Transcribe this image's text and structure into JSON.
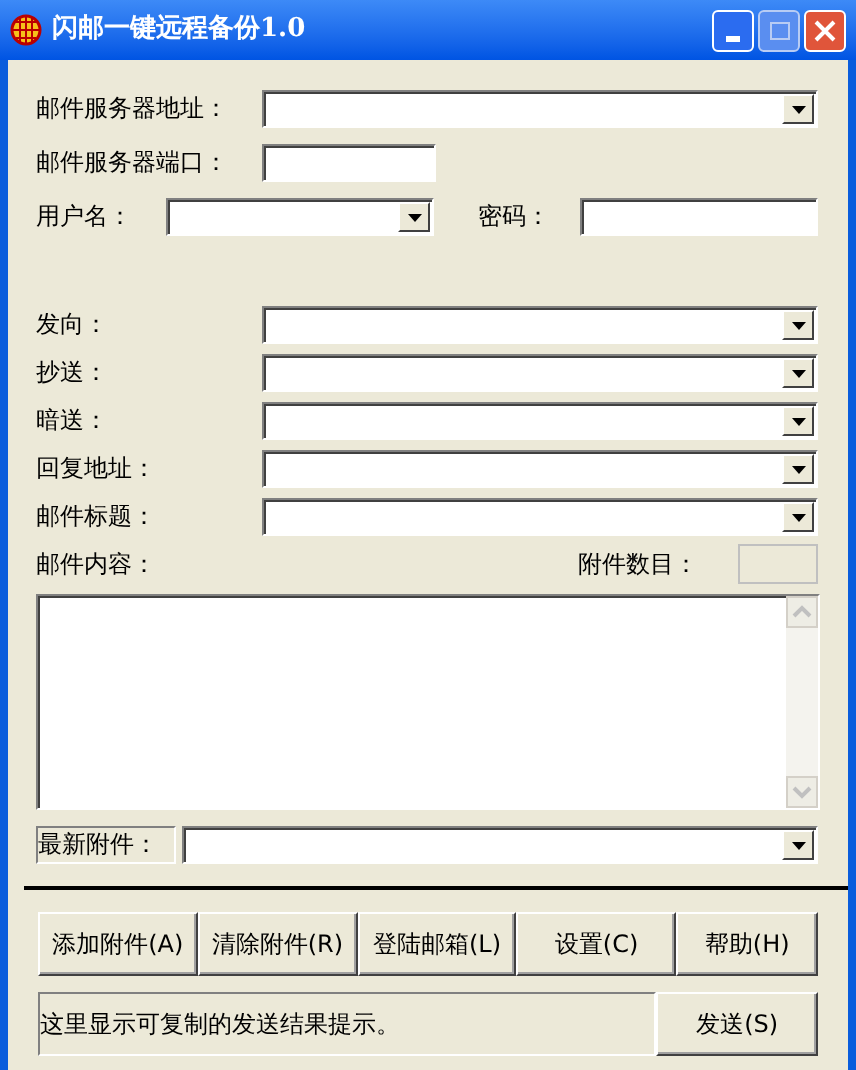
{
  "window": {
    "title": "闪邮一键远程备份1.0"
  },
  "server_address": {
    "label": "邮件服务器地址："
  },
  "server_port": {
    "label": "邮件服务器端口："
  },
  "username": {
    "label": "用户名："
  },
  "password": {
    "label": "密码："
  },
  "recipients": [
    {
      "label": "发向："
    },
    {
      "label": "抄送："
    },
    {
      "label": "暗送："
    },
    {
      "label": "回复地址："
    },
    {
      "label": "邮件标题："
    }
  ],
  "content": {
    "label": "邮件内容："
  },
  "attachment_count": {
    "label": "附件数目："
  },
  "latest_attachment": {
    "label": "最新附件："
  },
  "buttons": [
    {
      "label": "添加附件(A)"
    },
    {
      "label": "清除附件(R)"
    },
    {
      "label": "登陆邮箱(L)"
    },
    {
      "label": "设置(C)"
    },
    {
      "label": "帮助(H)"
    }
  ],
  "status": {
    "text": "这里显示可复制的发送结果提示。"
  },
  "send_button": {
    "label": "发送(S)"
  }
}
